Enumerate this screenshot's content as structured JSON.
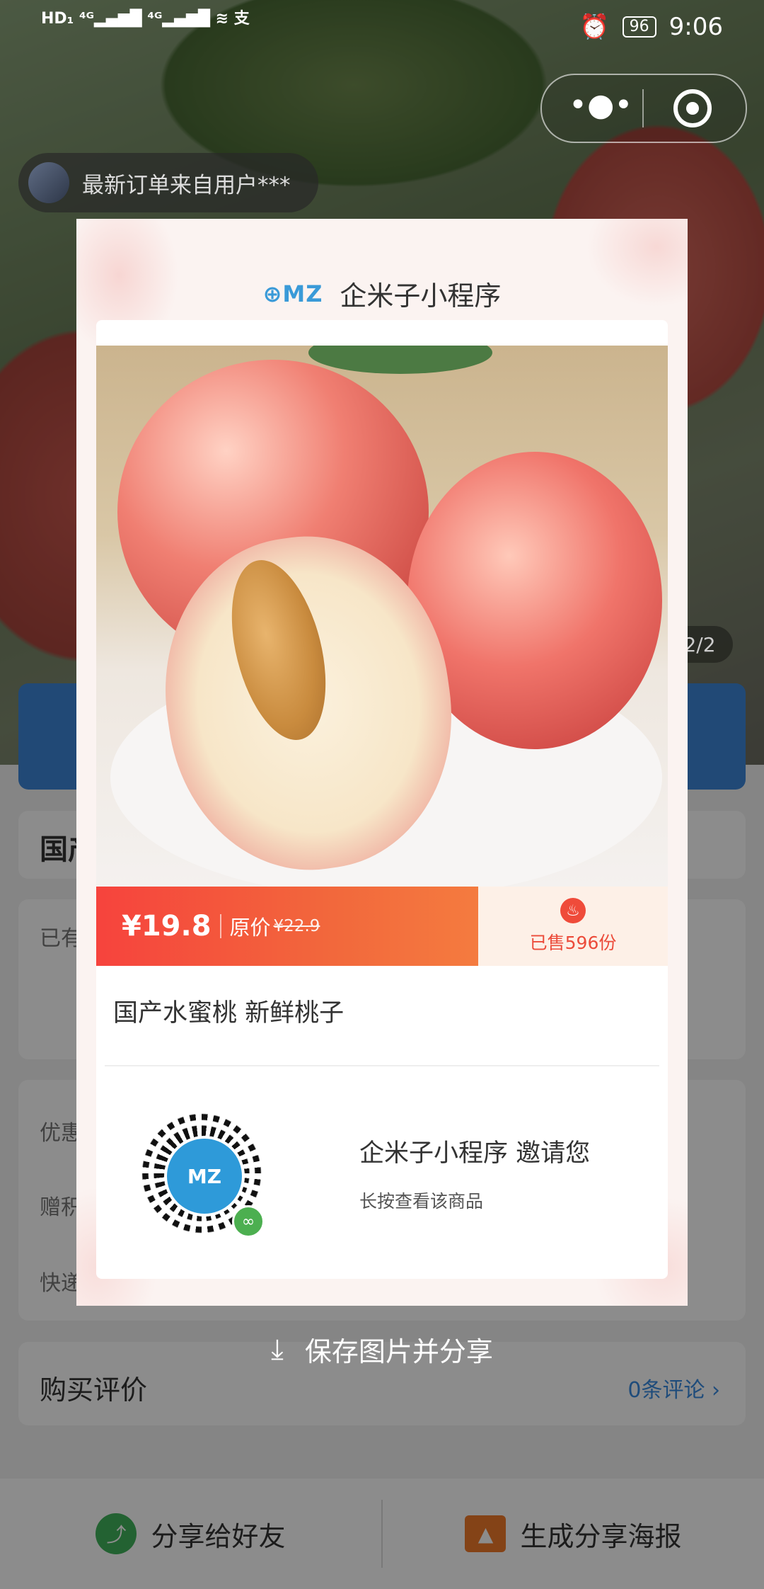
{
  "status_bar": {
    "time": "9:06",
    "battery": "96"
  },
  "top": {
    "order_notice": "最新订单来自用户***",
    "page_indicator": "2/2"
  },
  "background": {
    "product_title_partial": "国产",
    "existing_label_partial": "已有",
    "rows": [
      "优惠",
      "赠积",
      "快递"
    ],
    "review_title": "购买评价",
    "review_link": "0条评论"
  },
  "poster": {
    "brand_logo_text": "MZ",
    "brand_name": "企米子小程序",
    "price": "¥19.8",
    "original_label": "原价",
    "original_price": "¥22.9",
    "sold": "已售596份",
    "product_title": "国产水蜜桃 新鲜桃子",
    "qr_center_text": "MZ",
    "invite_text": "企米子小程序 邀请您",
    "hint_text": "长按查看该商品"
  },
  "save_button": "保存图片并分享",
  "bottom_bar": {
    "share_friend": "分享给好友",
    "gen_poster": "生成分享海报"
  },
  "colors": {
    "accent_blue": "#3a8be0",
    "price_red": "#f6433d",
    "share_green": "#41b35b",
    "poster_orange": "#f07a2a"
  }
}
